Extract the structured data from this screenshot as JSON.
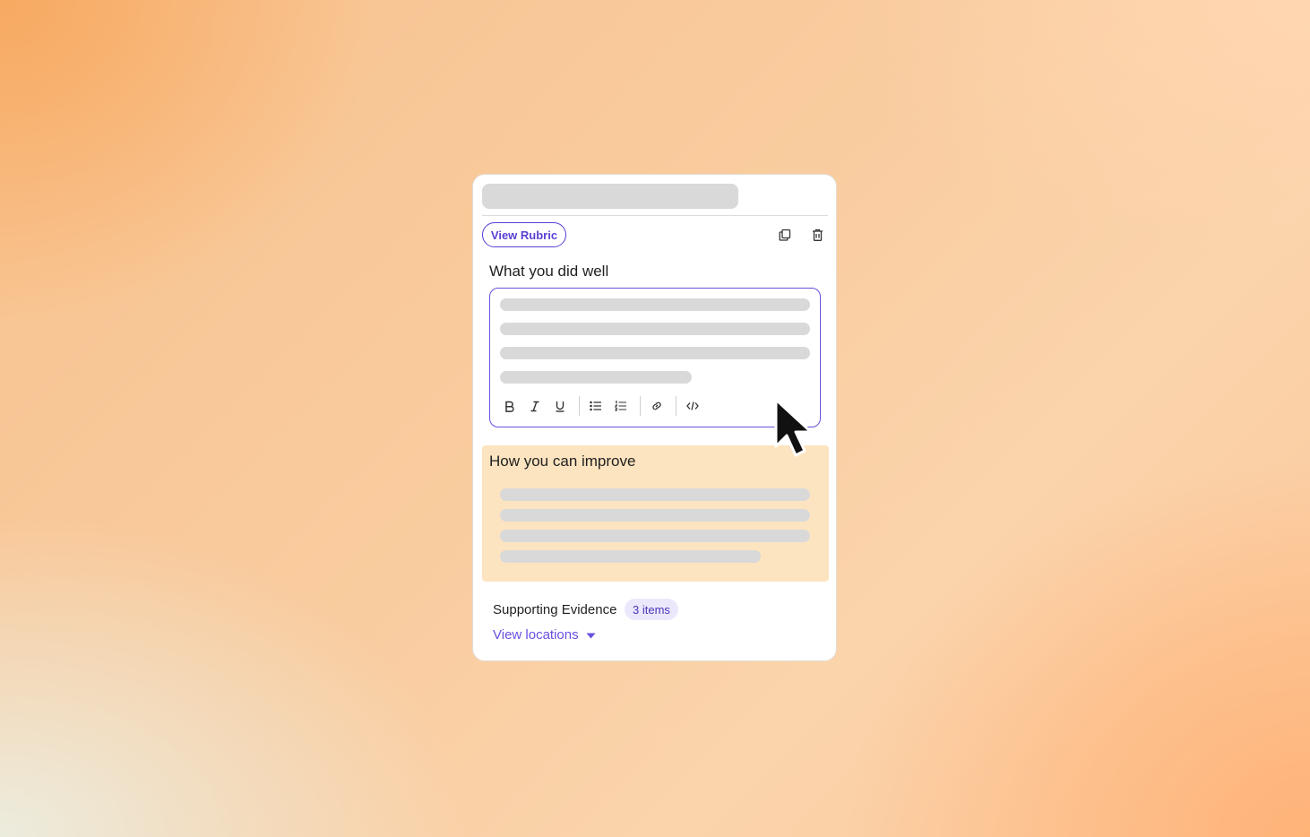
{
  "card": {
    "view_rubric_label": "View Rubric",
    "copy_icon": "copy-icon",
    "delete_icon": "trash-icon"
  },
  "well_section": {
    "label": "What you did well",
    "border_color": "#6a4fe0",
    "toolbar": [
      {
        "name": "bold",
        "icon": "bold-icon",
        "glyph": "B"
      },
      {
        "name": "italic",
        "icon": "italic-icon",
        "glyph": "I"
      },
      {
        "name": "underline",
        "icon": "underline-icon",
        "glyph": "U"
      },
      {
        "name": "bulleted-list",
        "icon": "bulleted-list-icon"
      },
      {
        "name": "numbered-list",
        "icon": "numbered-list-icon"
      },
      {
        "name": "link",
        "icon": "link-icon"
      },
      {
        "name": "code",
        "icon": "code-icon"
      }
    ]
  },
  "improve_section": {
    "label": "How you can improve",
    "background": "#fde4c0"
  },
  "evidence": {
    "label": "Supporting Evidence",
    "count_badge": "3 items",
    "view_locations_label": "View locations"
  },
  "colors": {
    "accent": "#5b3fd6",
    "skeleton": "#d9d9d9"
  }
}
